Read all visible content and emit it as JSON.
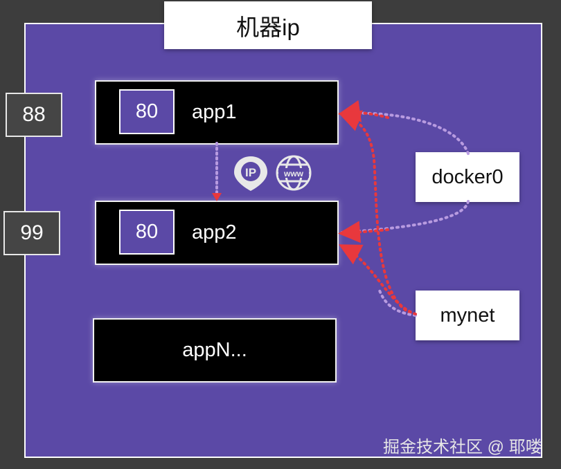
{
  "host": {
    "title": "机器ip"
  },
  "host_ports": {
    "port1": "88",
    "port2": "99"
  },
  "apps": [
    {
      "port": "80",
      "label": "app1"
    },
    {
      "port": "80",
      "label": "app2"
    },
    {
      "label": "appN..."
    }
  ],
  "networks": {
    "docker0": "docker0",
    "mynet": "mynet"
  },
  "icons": {
    "ip": "ip-pin-icon",
    "web": "www-globe-icon"
  },
  "watermark": "掘金技术社区 @ 耶喽",
  "colors": {
    "host_bg": "#5b49a6",
    "arrow_red": "#e8383d",
    "link_purple": "#9b7fd0"
  }
}
